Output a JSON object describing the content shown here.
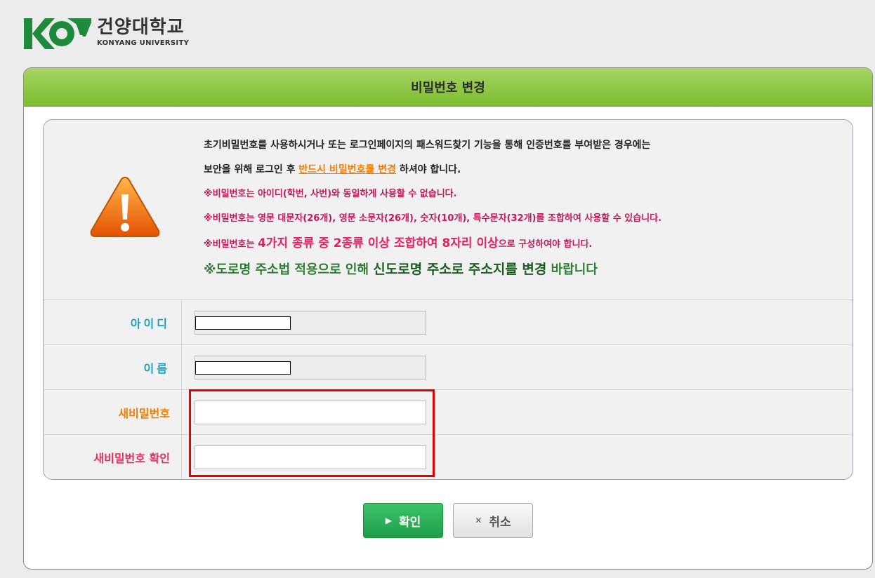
{
  "logo": {
    "korean_name": "건양대학교",
    "english_name": "KONYANG UNIVERSITY",
    "brand_color": "#1e8a3c"
  },
  "panel": {
    "title": "비밀번호 변경",
    "header_color": "#8cc63f"
  },
  "notice": {
    "line1": "초기비밀번호를 사용하시거나 또는 로그인페이지의 패스워드찾기 기능을 통해 인증번호를 부여받은 경우에는",
    "line2_prefix": "보안을 위해 로그인 후 ",
    "line2_highlight": "반드시 비밀번호를 변경",
    "line2_suffix": " 하셔야 합니다.",
    "line3": "※비밀번호는 아이디(학번, 사번)와 동일하게 사용할 수 없습니다.",
    "line4": "※비밀번호는 영문 대문자(26개), 영문 소문자(26개), 숫자(10개), 특수문자(32개)를 조합하여 사용할 수 있습니다.",
    "line5_prefix": "※비밀번호는 ",
    "line5_highlight": "4가지 종류 중 2종류 이상 조합하여 8자리 이상",
    "line5_suffix": "으로 구성하여야 합니다.",
    "line6_a": "※도로명 주소법 적용으로 인해 ",
    "line6_b": "신도로명 주소로 주소지를 변경",
    "line6_c": " 바랍니다",
    "icon": "warning-icon"
  },
  "form": {
    "id_label": "아이디",
    "name_label": "이름",
    "new_password_label": "새비밀번호",
    "confirm_password_label": "새비밀번호 확인",
    "id_value": "",
    "name_value": "",
    "new_password_value": "",
    "confirm_password_value": ""
  },
  "buttons": {
    "ok_label": "확인",
    "cancel_label": "취소",
    "ok_icon": "play-icon",
    "cancel_icon": "close-icon"
  },
  "colors": {
    "ok_button": "#28a745",
    "highlight_box": "#e30000",
    "label_blue": "#1c9ec7",
    "label_orange": "#f57c00",
    "label_pink": "#e0325c"
  }
}
